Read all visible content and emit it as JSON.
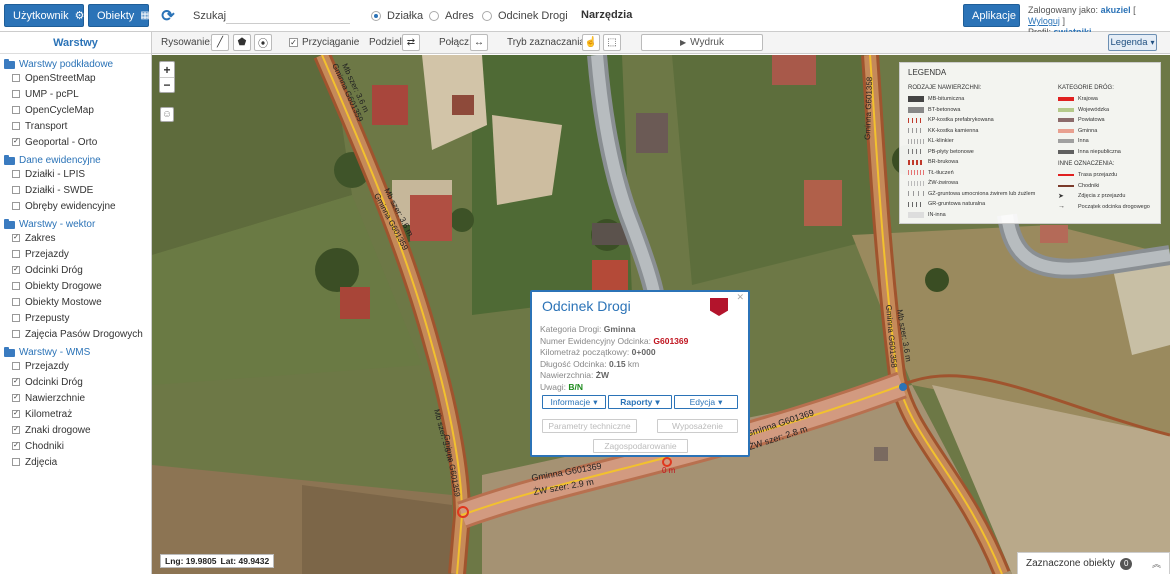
{
  "header": {
    "user_button": "Użytkownik",
    "objects_button": "Obiekty",
    "search_label": "Szukaj:",
    "search_placeholder": "",
    "radios": [
      {
        "label": "Działka",
        "selected": true
      },
      {
        "label": "Adres",
        "selected": false
      },
      {
        "label": "Odcinek Drogi",
        "selected": false
      }
    ],
    "tools_title": "Narzędzia",
    "apps_button": "Aplikacje",
    "login_prefix": "Zalogowany jako:",
    "login_user": "akuziel",
    "logout": "Wyloguj",
    "profile_prefix": "Profil:",
    "profile_name": "swiatniki"
  },
  "toolbar": {
    "draw_label": "Rysowanie:",
    "snap_label": "Przyciąganie",
    "split_label": "Podziel:",
    "join_label": "Połącz:",
    "select_mode_label": "Tryb zaznaczania:",
    "print_label": "Wydruk",
    "legend_label": "Legenda"
  },
  "sidebar": {
    "title": "Warstwy",
    "groups": [
      {
        "label": "Warstwy podkładowe",
        "items": [
          {
            "label": "OpenStreetMap",
            "checked": false
          },
          {
            "label": "UMP - pcPL",
            "checked": false
          },
          {
            "label": "OpenCycleMap",
            "checked": false
          },
          {
            "label": "Transport",
            "checked": false
          },
          {
            "label": "Geoportal - Orto",
            "checked": true
          }
        ]
      },
      {
        "label": "Dane ewidencyjne",
        "items": [
          {
            "label": "Działki - LPIS",
            "checked": false
          },
          {
            "label": "Działki - SWDE",
            "checked": false
          },
          {
            "label": "Obręby ewidencyjne",
            "checked": false
          }
        ]
      },
      {
        "label": "Warstwy - wektor",
        "items": [
          {
            "label": "Zakres",
            "checked": true
          },
          {
            "label": "Przejazdy",
            "checked": false
          },
          {
            "label": "Odcinki Dróg",
            "checked": true
          },
          {
            "label": "Obiekty Drogowe",
            "checked": false
          },
          {
            "label": "Obiekty Mostowe",
            "checked": false
          },
          {
            "label": "Przepusty",
            "checked": false
          },
          {
            "label": "Zajęcia Pasów Drogowych",
            "checked": false
          }
        ]
      },
      {
        "label": "Warstwy - WMS",
        "items": [
          {
            "label": "Przejazdy",
            "checked": false
          },
          {
            "label": "Odcinki Dróg",
            "checked": true
          },
          {
            "label": "Nawierzchnie",
            "checked": true
          },
          {
            "label": "Kilometraż",
            "checked": true
          },
          {
            "label": "Znaki drogowe",
            "checked": true
          },
          {
            "label": "Chodniki",
            "checked": true
          },
          {
            "label": "Zdjęcia",
            "checked": false
          }
        ]
      }
    ]
  },
  "map": {
    "coords_lng_label": "Lng:",
    "coords_lng": "19.9805",
    "coords_lat_label": "Lat:",
    "coords_lat": "49.9432",
    "road_labels": [
      "Mb szer: 3.6 m",
      "Gminna G601359",
      "Mb szer: 3.6 m",
      "Gminna G601359",
      "Mb szer: 3.6 m",
      "Gminna G601359",
      "Gminna G601369",
      "ŻW szer: 2.9 m",
      "Gminna G601369",
      "ŻW szer: 2.8 m",
      "Gminna G601358",
      "Mb szer: 3.6 m",
      "Gminna G601358",
      "0 m"
    ]
  },
  "legend": {
    "title": "LEGENDA",
    "surfaces_title": "RODZAJE NAWIERZCHNI:",
    "surfaces": [
      {
        "label": "MB-bitumiczna",
        "color": "#444444"
      },
      {
        "label": "BT-betonowa",
        "color": "#888888"
      },
      {
        "label": "KP-kostka prefabrykowana",
        "color": "#c0392b"
      },
      {
        "label": "KK-kostka kamienna",
        "color": "#999999"
      },
      {
        "label": "KL-klinkier",
        "color": "#aaaaaa"
      },
      {
        "label": "PB-płyty betonowe",
        "color": "#777777"
      },
      {
        "label": "BR-brukowa",
        "color": "#c0392b"
      },
      {
        "label": "TŁ-tłuczeń",
        "color": "#e57373"
      },
      {
        "label": "ŻW-żwirowa",
        "color": "#bbbbbb"
      },
      {
        "label": "GŻ-gruntowa umocniona żwirem lub żużlem",
        "color": "#999999"
      },
      {
        "label": "GR-gruntowa naturalna",
        "color": "#666666"
      },
      {
        "label": "IN-inna",
        "color": "#dddddd"
      }
    ],
    "categories_title": "KATEGORIE DRÓG:",
    "categories": [
      {
        "label": "Krajowa",
        "color": "#e02020"
      },
      {
        "label": "Wojewódzka",
        "color": "#b5c98a"
      },
      {
        "label": "Powiatowa",
        "color": "#8c6b6b"
      },
      {
        "label": "Gminna",
        "color": "#e8a090"
      },
      {
        "label": "Inna",
        "color": "#a0a0a0"
      },
      {
        "label": "Inna niepubliczna",
        "color": "#606060"
      }
    ],
    "other_title": "INNE OZNACZENIA:",
    "other": [
      {
        "label": "Trasa przejazdu",
        "color": "#e02020"
      },
      {
        "label": "Chodniki",
        "color": "#7a3a2a"
      },
      {
        "label": "Zdjęcia z przejazdu",
        "color": "#333333"
      },
      {
        "label": "Początek odcinka drogowego",
        "color": "#333333"
      }
    ]
  },
  "popup": {
    "title": "Odcinek Drogi",
    "category_label": "Kategoria Drogi:",
    "category": "Gminna",
    "number_label": "Numer Ewidencyjny Odcinka:",
    "number": "G601369",
    "km_label": "Kilometraż początkowy:",
    "km": "0+000",
    "length_label": "Długość Odcinka:",
    "length": "0.15",
    "length_unit": "km",
    "surface_label": "Nawierzchnia:",
    "surface": "ŻW",
    "notes_label": "Uwagi:",
    "notes": "B/N",
    "btn_info": "Informacje",
    "btn_reports": "Raporty",
    "btn_edit": "Edycja",
    "btn_params": "Parametry techniczne",
    "btn_equipment": "Wyposażenie",
    "btn_land": "Zagospodarowanie"
  },
  "selected_objects": {
    "label": "Zaznaczone obiekty",
    "count": "0"
  }
}
